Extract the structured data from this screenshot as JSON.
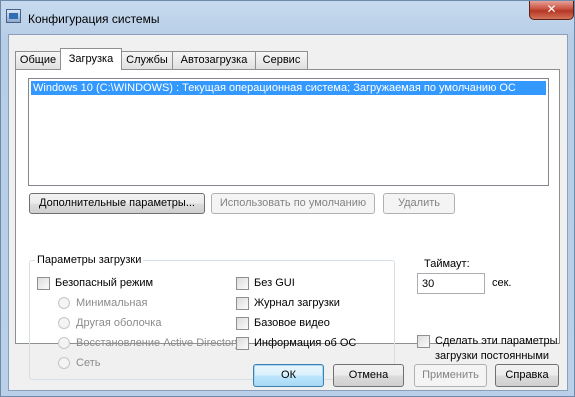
{
  "window": {
    "title": "Конфигурация системы",
    "close_glyph": "✕",
    "app_icon": "msconfig-icon"
  },
  "tabs": [
    {
      "label": "Общие",
      "active": false
    },
    {
      "label": "Загрузка",
      "active": true
    },
    {
      "label": "Службы",
      "active": false
    },
    {
      "label": "Автозагрузка",
      "active": false
    },
    {
      "label": "Сервис",
      "active": false
    }
  ],
  "boot_list": {
    "entries": [
      {
        "text": "Windows 10 (C:\\WINDOWS) : Текущая операционная система; Загружаемая по умолчанию ОС",
        "selected": true
      }
    ]
  },
  "list_buttons": {
    "advanced": "Дополнительные параметры...",
    "set_default": "Использовать по умолчанию",
    "delete": "Удалить"
  },
  "boot_options": {
    "legend": "Параметры загрузки",
    "safe_boot": {
      "label": "Безопасный режим",
      "checked": false
    },
    "radios": [
      {
        "label": "Минимальная",
        "enabled": false
      },
      {
        "label": "Другая оболочка",
        "enabled": false
      },
      {
        "label": "Восстановление Active Directory",
        "enabled": false
      },
      {
        "label": "Сеть",
        "enabled": false
      }
    ],
    "no_gui": {
      "label": "Без GUI",
      "checked": false
    },
    "boot_log": {
      "label": "Журнал загрузки",
      "checked": false
    },
    "base_video": {
      "label": "Базовое видео",
      "checked": false
    },
    "os_info": {
      "label": "Информация  об ОС",
      "checked": false
    }
  },
  "timeout": {
    "label": "Таймаут:",
    "value": "30",
    "unit": "сек."
  },
  "permanent": {
    "label_line1": "Сделать эти параметры",
    "label_line2": "загрузки постоянными",
    "checked": false
  },
  "footer_buttons": {
    "ok": "ОК",
    "cancel": "Отмена",
    "apply": "Применить",
    "help": "Справка"
  },
  "colors": {
    "selection": "#3399ff",
    "close_button": "#c7503d",
    "window_frame": "#b9d1ea"
  }
}
